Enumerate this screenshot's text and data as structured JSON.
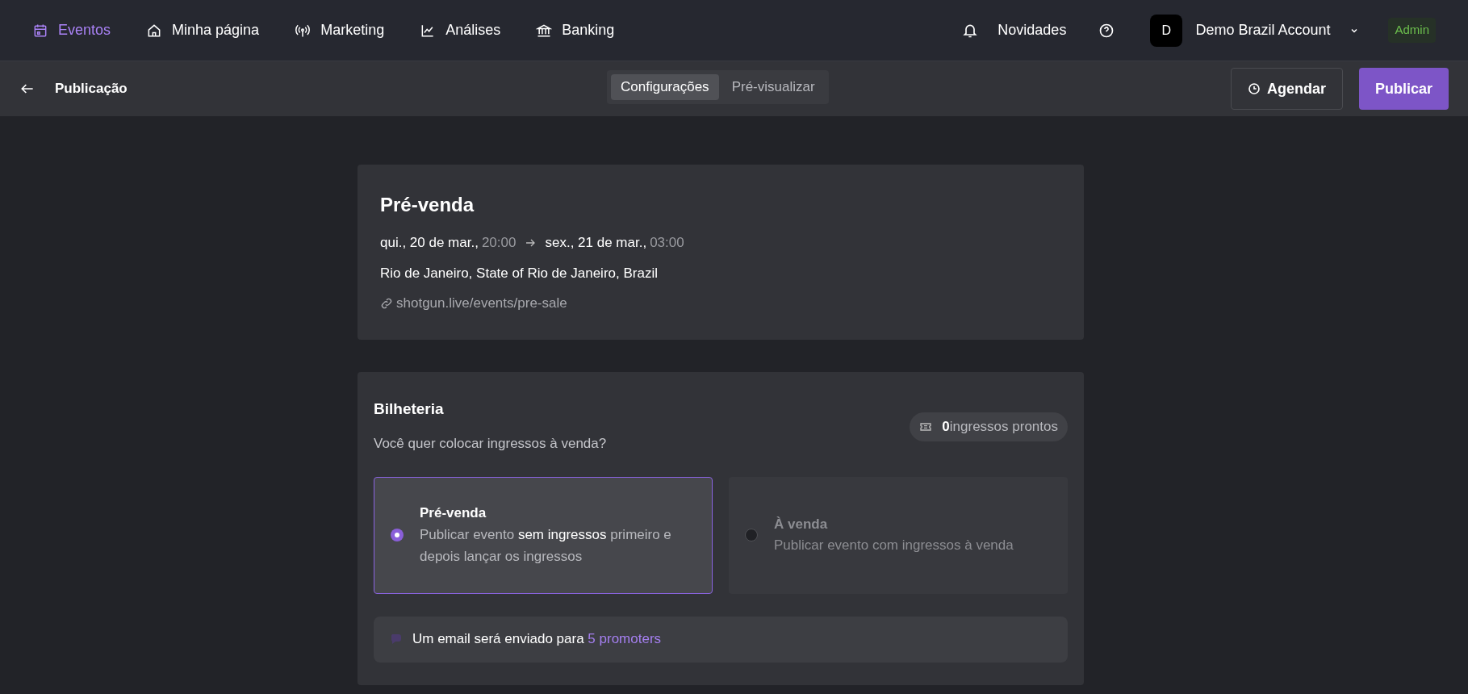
{
  "nav": {
    "items": [
      {
        "label": "Eventos",
        "selected": true
      },
      {
        "label": "Minha página",
        "selected": false
      },
      {
        "label": "Marketing",
        "selected": false
      },
      {
        "label": "Análises",
        "selected": false
      },
      {
        "label": "Banking",
        "selected": false
      }
    ],
    "news": "Novidades",
    "avatar": "D",
    "account": "Demo Brazil Account",
    "role": "Admin"
  },
  "toolbar": {
    "title": "Publicação",
    "tabs": [
      {
        "label": "Configurações",
        "selected": true
      },
      {
        "label": "Pré-visualizar",
        "selected": false
      }
    ],
    "schedule_button": "Agendar",
    "publish_button": "Publicar"
  },
  "event": {
    "title": "Pré-venda",
    "start_date": "qui., 20 de mar.,",
    "start_time": "20:00",
    "end_date": "sex., 21 de mar.,",
    "end_time": "03:00",
    "location": "Rio de Janeiro, State of Rio de Janeiro, Brazil",
    "url": "shotgun.live/events/pre-sale"
  },
  "ticketing": {
    "title": "Bilheteria",
    "question": "Você quer colocar ingressos à venda?",
    "tickets_badge": "**0**ingressos prontos",
    "options": [
      {
        "title": "Pré-venda",
        "description": "Publicar evento **sem ingressos** primeiro e depois lançar os ingressos",
        "selected": true
      },
      {
        "title": "À venda",
        "description": "Publicar evento com ingressos à venda",
        "selected": false
      }
    ],
    "email_note": "Um email será enviado para",
    "promoters_link": "5 promoters"
  }
}
